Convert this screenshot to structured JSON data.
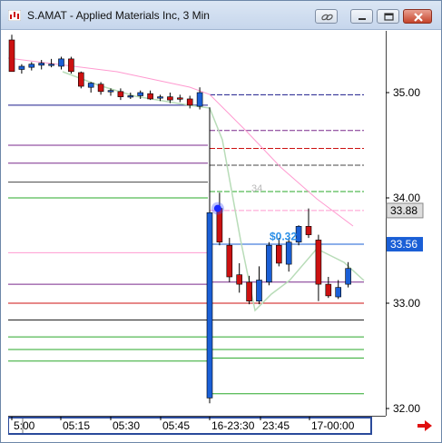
{
  "window": {
    "title": "S.AMAT - Applied Materials Inc, 3 Min"
  },
  "icons": {
    "app": "chart-app-icon",
    "link": "link-icon",
    "minimize": "minimize-icon",
    "maximize": "maximize-icon",
    "close": "close-icon",
    "scroll_right": "scroll-right-arrow-icon"
  },
  "colors": {
    "up_candle": "#1a5fd6",
    "down_candle": "#cc1111",
    "price_label_dark": "#dddddd",
    "price_label_blue": "#1a5fd6",
    "annotation": "#2a8fe8",
    "scroll_arrow": "#e01010"
  },
  "chart_data": {
    "type": "candlestick",
    "symbol": "S.AMAT",
    "interval": "3 Min",
    "ylim": [
      32.0,
      35.5
    ],
    "y_ticks": [
      35.0,
      34.0,
      33.0,
      32.0
    ],
    "y_tick_labels": [
      "35.00",
      "34.00",
      "33.00",
      "32.00"
    ],
    "x_tick_labels": [
      "5:00",
      "05:15",
      "05:30",
      "05:45",
      "16-23:30",
      "23:45",
      "17-00:00"
    ],
    "price_labels": [
      {
        "value": 33.88,
        "text": "33.88",
        "style": "dark"
      },
      {
        "value": 33.56,
        "text": "33.56",
        "style": "blue"
      }
    ],
    "annotations": [
      {
        "text": "$0.32",
        "y": 33.6
      },
      {
        "text": "34",
        "y": 34.06
      }
    ],
    "candles": [
      {
        "o": 35.5,
        "h": 35.55,
        "l": 35.2,
        "c": 35.2
      },
      {
        "o": 35.22,
        "h": 35.27,
        "l": 35.18,
        "c": 35.25
      },
      {
        "o": 35.24,
        "h": 35.29,
        "l": 35.21,
        "c": 35.27
      },
      {
        "o": 35.26,
        "h": 35.31,
        "l": 35.22,
        "c": 35.28
      },
      {
        "o": 35.27,
        "h": 35.32,
        "l": 35.24,
        "c": 35.27
      },
      {
        "o": 35.25,
        "h": 35.34,
        "l": 35.22,
        "c": 35.32
      },
      {
        "o": 35.32,
        "h": 35.34,
        "l": 35.18,
        "c": 35.2
      },
      {
        "o": 35.19,
        "h": 35.2,
        "l": 35.04,
        "c": 35.06
      },
      {
        "o": 35.05,
        "h": 35.1,
        "l": 35.0,
        "c": 35.09
      },
      {
        "o": 35.08,
        "h": 35.1,
        "l": 34.98,
        "c": 35.01
      },
      {
        "o": 35.01,
        "h": 35.04,
        "l": 34.97,
        "c": 35.02
      },
      {
        "o": 35.01,
        "h": 35.04,
        "l": 34.93,
        "c": 34.96
      },
      {
        "o": 34.96,
        "h": 35.0,
        "l": 34.94,
        "c": 34.97
      },
      {
        "o": 34.97,
        "h": 35.02,
        "l": 34.94,
        "c": 35.0
      },
      {
        "o": 34.99,
        "h": 35.02,
        "l": 34.93,
        "c": 34.94
      },
      {
        "o": 34.95,
        "h": 34.98,
        "l": 34.92,
        "c": 34.96
      },
      {
        "o": 34.96,
        "h": 35.0,
        "l": 34.9,
        "c": 34.93
      },
      {
        "o": 34.95,
        "h": 34.98,
        "l": 34.91,
        "c": 34.94
      },
      {
        "o": 34.94,
        "h": 34.97,
        "l": 34.85,
        "c": 34.88
      },
      {
        "o": 34.87,
        "h": 35.05,
        "l": 34.84,
        "c": 35.0
      },
      {
        "o": 32.1,
        "h": 34.86,
        "l": 32.05,
        "c": 33.86
      },
      {
        "o": 33.9,
        "h": 34.05,
        "l": 33.55,
        "c": 33.58
      },
      {
        "o": 33.55,
        "h": 33.62,
        "l": 33.2,
        "c": 33.25
      },
      {
        "o": 33.27,
        "h": 33.38,
        "l": 33.1,
        "c": 33.18
      },
      {
        "o": 33.2,
        "h": 33.26,
        "l": 32.99,
        "c": 33.02
      },
      {
        "o": 33.02,
        "h": 33.35,
        "l": 32.99,
        "c": 33.22
      },
      {
        "o": 33.2,
        "h": 33.58,
        "l": 33.17,
        "c": 33.55
      },
      {
        "o": 33.55,
        "h": 33.62,
        "l": 33.35,
        "c": 33.38
      },
      {
        "o": 33.37,
        "h": 33.62,
        "l": 33.3,
        "c": 33.58
      },
      {
        "o": 33.58,
        "h": 33.74,
        "l": 33.55,
        "c": 33.73
      },
      {
        "o": 33.73,
        "h": 33.9,
        "l": 33.62,
        "c": 33.65
      },
      {
        "o": 33.6,
        "h": 33.65,
        "l": 33.02,
        "c": 33.18
      },
      {
        "o": 33.18,
        "h": 33.25,
        "l": 33.05,
        "c": 33.07
      },
      {
        "o": 33.06,
        "h": 33.22,
        "l": 33.04,
        "c": 33.15
      },
      {
        "o": 33.18,
        "h": 33.39,
        "l": 33.15,
        "c": 33.33
      }
    ]
  }
}
